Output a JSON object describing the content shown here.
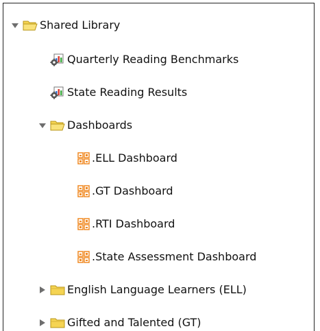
{
  "tree": {
    "root": {
      "label": "Shared Library",
      "expanded": true,
      "icon": "folder-open-icon"
    },
    "reports": [
      {
        "label": "Quarterly Reading Benchmarks",
        "icon": "report-gear-icon"
      },
      {
        "label": "State Reading Results",
        "icon": "report-gear-icon"
      }
    ],
    "dashboards_folder": {
      "label": "Dashboards",
      "expanded": true,
      "icon": "folder-open-icon"
    },
    "dashboards": [
      {
        "label": ".ELL Dashboard",
        "icon": "dashboard-icon"
      },
      {
        "label": ".GT Dashboard",
        "icon": "dashboard-icon"
      },
      {
        "label": ".RTI Dashboard",
        "icon": "dashboard-icon"
      },
      {
        "label": ".State Assessment Dashboard",
        "icon": "dashboard-icon"
      }
    ],
    "folders": [
      {
        "label": "English Language Learners (ELL)",
        "expanded": false,
        "icon": "folder-closed-icon"
      },
      {
        "label": "Gifted and Talented (GT)",
        "expanded": false,
        "icon": "folder-closed-icon"
      }
    ]
  },
  "colors": {
    "folder_fill": "#f5d453",
    "folder_stroke": "#b8961a",
    "arrow": "#6e6e6e",
    "dashboard_orange": "#f08a24",
    "report_gear": "#555555",
    "report_blue": "#2f6fd1",
    "report_red": "#d63b2f",
    "report_green": "#3faa3f"
  }
}
